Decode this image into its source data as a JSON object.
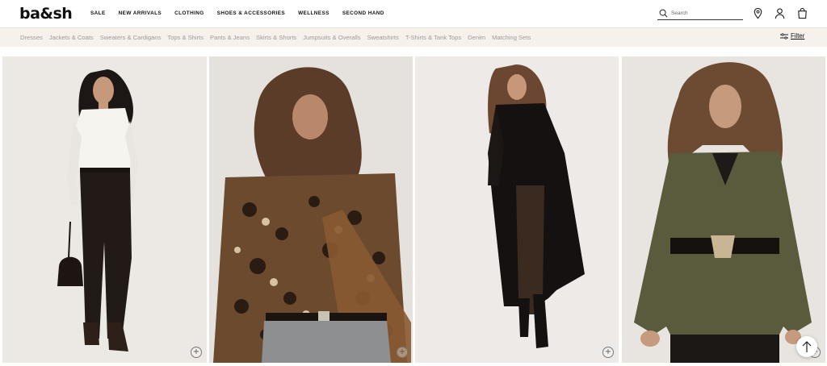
{
  "brand": {
    "logo_text": "ba&sh"
  },
  "main_nav": [
    "SALE",
    "NEW ARRIVALS",
    "CLOTHING",
    "SHOES & ACCESSORIES",
    "WELLNESS",
    "SECOND HAND"
  ],
  "search": {
    "placeholder": "Search",
    "value": ""
  },
  "header_icons": [
    "store-locator-icon",
    "account-icon",
    "bag-icon"
  ],
  "categories": [
    "Dresses",
    "Jackets & Coats",
    "Sweaters & Cardigans",
    "Tops & Shirts",
    "Pants & Jeans",
    "Skirts & Shorts",
    "Jumpsuits & Overalls",
    "Sweatshirts",
    "T-Shirts & Tank Tops",
    "Denim",
    "Matching Sets"
  ],
  "filter": {
    "label": "Filter"
  },
  "products": [
    {
      "name": "product-white-knit-leather-pants",
      "bg": "#ede9e4",
      "quick_add": "+"
    },
    {
      "name": "product-leopard-print-shirt",
      "bg": "#e6e3e0",
      "quick_add": "+"
    },
    {
      "name": "product-black-long-coat",
      "bg": "#eeebe8",
      "quick_add": "+"
    },
    {
      "name": "product-khaki-belted-jacket",
      "bg": "#e9e6e2",
      "quick_add": "+"
    }
  ],
  "colors": {
    "category_bar_bg": "#f7f1ec",
    "category_text": "#a09a95",
    "text": "#111111"
  }
}
